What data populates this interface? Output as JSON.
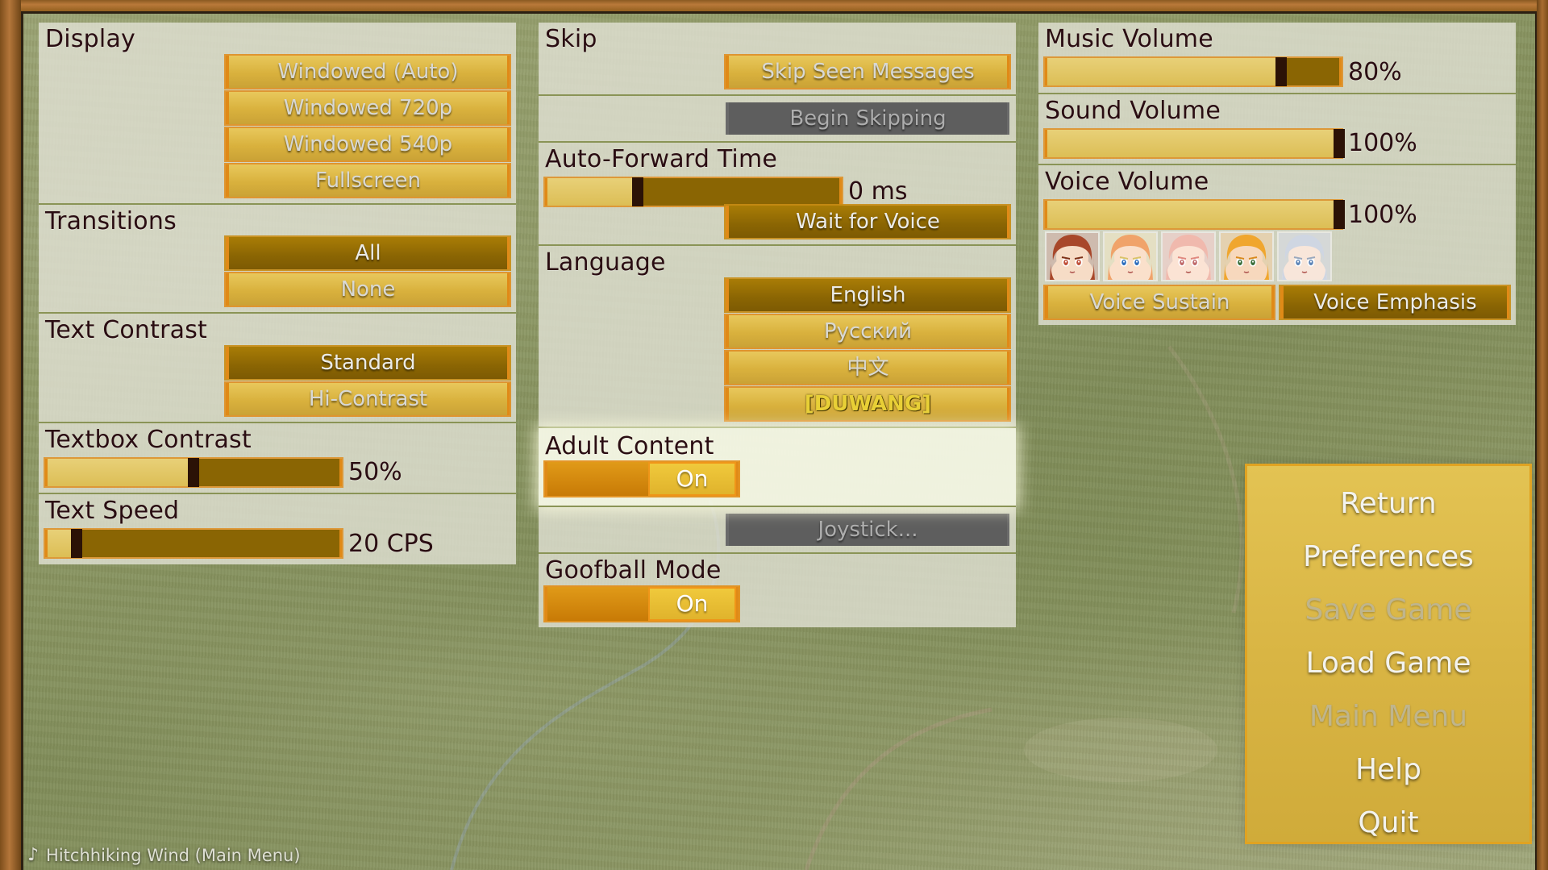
{
  "window": {
    "music_note_icon": "music-note",
    "music_status": "Hitchhiking Wind (Main Menu)"
  },
  "preferences": {
    "columns": [
      {
        "id": "left",
        "sections": [
          {
            "label": "Display",
            "type": "buttons",
            "buttons": [
              {
                "label": "Windowed (Auto)",
                "selected": false,
                "disabled": false
              },
              {
                "label": "Windowed 720p",
                "selected": false,
                "disabled": false
              },
              {
                "label": "Windowed 540p",
                "selected": false,
                "disabled": false
              },
              {
                "label": "Fullscreen",
                "selected": false,
                "disabled": false
              }
            ]
          },
          {
            "label": "Transitions",
            "type": "buttons",
            "buttons": [
              {
                "label": "All",
                "selected": true,
                "disabled": false
              },
              {
                "label": "None",
                "selected": false,
                "disabled": false
              }
            ]
          },
          {
            "label": "Text Contrast",
            "type": "buttons",
            "buttons": [
              {
                "label": "Standard",
                "selected": true,
                "disabled": false
              },
              {
                "label": "Hi-Contrast",
                "selected": false,
                "disabled": false
              }
            ]
          },
          {
            "label": "Textbox Contrast",
            "type": "slider",
            "slider": {
              "percent": 50,
              "value_text": "50%"
            }
          },
          {
            "label": "Text Speed",
            "type": "slider",
            "slider": {
              "percent": 10,
              "value_text": "20 CPS"
            }
          }
        ]
      },
      {
        "id": "middle",
        "sections": [
          {
            "label": "Skip",
            "type": "buttons",
            "buttons": [
              {
                "label": "Skip Seen Messages",
                "selected": false,
                "disabled": false
              }
            ]
          },
          {
            "label": "",
            "type": "buttons",
            "buttons": [
              {
                "label": "Begin Skipping",
                "selected": false,
                "disabled": true
              }
            ]
          },
          {
            "label": "Auto-Forward Time",
            "type": "slider-buttons",
            "slider": {
              "percent": 31,
              "value_text": "0 ms"
            },
            "buttons": [
              {
                "label": "Wait for Voice",
                "selected": true,
                "disabled": false
              }
            ]
          },
          {
            "label": "Language",
            "type": "buttons",
            "buttons": [
              {
                "label": "English",
                "selected": true,
                "disabled": false,
                "style": "normal"
              },
              {
                "label": "Русский",
                "selected": false,
                "disabled": false,
                "style": "normal"
              },
              {
                "label": "中文",
                "selected": false,
                "disabled": false,
                "style": "normal"
              },
              {
                "label": "[DUWANG]",
                "selected": false,
                "disabled": false,
                "style": "duwang"
              }
            ]
          },
          {
            "label": "Adult Content",
            "type": "toggle",
            "highlight": true,
            "toggle": {
              "state_label": "On",
              "on": true
            }
          },
          {
            "label": "",
            "type": "buttons",
            "buttons": [
              {
                "label": "Joystick...",
                "selected": false,
                "disabled": true
              }
            ]
          },
          {
            "label": "Goofball Mode",
            "type": "toggle",
            "highlight": false,
            "toggle": {
              "state_label": "On",
              "on": true
            }
          }
        ]
      },
      {
        "id": "right",
        "sections": [
          {
            "label": "Music Volume",
            "type": "slider",
            "slider": {
              "percent": 80,
              "value_text": "80%"
            }
          },
          {
            "label": "Sound Volume",
            "type": "slider",
            "slider": {
              "percent": 100,
              "value_text": "100%"
            }
          },
          {
            "label": "Voice Volume",
            "type": "slider-portraits",
            "slider": {
              "percent": 100,
              "value_text": "100%"
            },
            "portraits": [
              {
                "name": "portrait-character-1",
                "hair": "#a8472a",
                "skin": "#f6dcc6",
                "eye": "#c0503a",
                "accent": "#7e3218"
              },
              {
                "name": "portrait-character-2",
                "hair": "#f0a36a",
                "skin": "#fae0cb",
                "eye": "#2f6fbd",
                "accent": "#d9c36a"
              },
              {
                "name": "portrait-character-3",
                "hair": "#f0b9ad",
                "skin": "#fbe3d4",
                "eye": "#c06b6b",
                "accent": "#e0897f"
              },
              {
                "name": "portrait-character-4",
                "hair": "#f0a62e",
                "skin": "#f7d8bd",
                "eye": "#3b6f3b",
                "accent": "#d98a1f"
              },
              {
                "name": "portrait-character-5",
                "hair": "#cfd6e2",
                "skin": "#f8e6da",
                "eye": "#5f86b8",
                "accent": "#9aa8bd"
              }
            ],
            "buttons": [
              {
                "label": "Voice Sustain",
                "selected": false,
                "disabled": false
              },
              {
                "label": "Voice Emphasis",
                "selected": true,
                "disabled": false
              }
            ]
          }
        ]
      }
    ]
  },
  "game_menu": {
    "items": [
      {
        "label": "Return",
        "disabled": false
      },
      {
        "label": "Preferences",
        "disabled": false
      },
      {
        "label": "Save Game",
        "disabled": true
      },
      {
        "label": "Load Game",
        "disabled": false
      },
      {
        "label": "Main Menu",
        "disabled": true
      },
      {
        "label": "Help",
        "disabled": false
      },
      {
        "label": "Quit",
        "disabled": false
      }
    ]
  },
  "colors": {
    "gold": "#dcb63f",
    "gold_selected": "#8a6503",
    "gold_border": "#e08a17",
    "panel": "#e2e2d6",
    "divider": "#8a9456",
    "label_text": "#2a0d12",
    "button_text": "#d8d8d4",
    "disabled_bg": "#5e5e5e",
    "duwang_text": "#e8cf36",
    "toggle_track": "#d98a10"
  }
}
